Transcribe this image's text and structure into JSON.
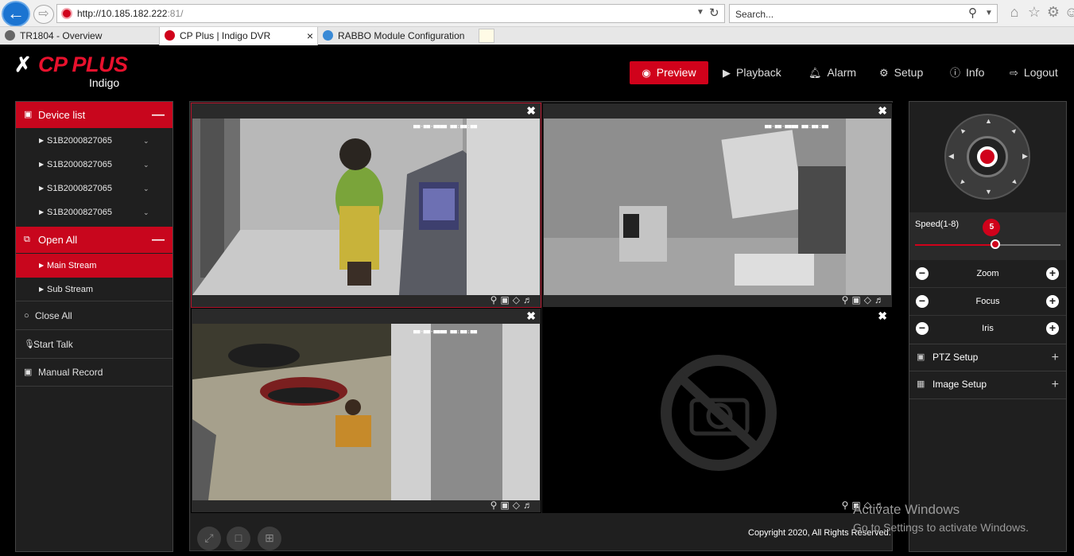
{
  "browser": {
    "url_host": "http://10.185.182.222",
    "url_port": ":81/",
    "search_placeholder": "Search...",
    "tabs": [
      {
        "label": "TR1804 - Overview"
      },
      {
        "label": "CP Plus | Indigo DVR",
        "close": "×"
      },
      {
        "label": "RABBO Module Configuration"
      }
    ]
  },
  "brand": {
    "name": "CP PLUS",
    "sub": "Indigo",
    "accent": "#d0021b"
  },
  "topnav": [
    {
      "label": "Preview",
      "icon": "eye-icon"
    },
    {
      "label": "Playback",
      "icon": "play-icon"
    },
    {
      "label": "Alarm",
      "icon": "bell-icon"
    },
    {
      "label": "Setup",
      "icon": "gear-icon"
    },
    {
      "label": "Info",
      "icon": "info-icon"
    },
    {
      "label": "Logout",
      "icon": "logout-icon"
    }
  ],
  "left": {
    "device_list": "Device list",
    "devices": [
      "S1B2000827065",
      "S1B2000827065",
      "S1B2000827065",
      "S1B2000827065"
    ],
    "open_all": "Open All",
    "main_stream": "Main Stream",
    "sub_stream": "Sub Stream",
    "close_all": "Close All",
    "start_talk": "Start Talk",
    "manual_record": "Manual Record"
  },
  "right": {
    "speed_label": "Speed(1-8)",
    "speed_value": "5",
    "speed_min": 1,
    "speed_max": 8,
    "zoom": "Zoom",
    "focus": "Focus",
    "iris": "Iris",
    "ptz_setup": "PTZ Setup",
    "image_setup": "Image Setup"
  },
  "footer": {
    "copyright": "Copyright 2020, All Rights Reserved.",
    "watermark_title": "Activate Windows",
    "watermark_sub": "Go to Settings to activate Windows."
  }
}
